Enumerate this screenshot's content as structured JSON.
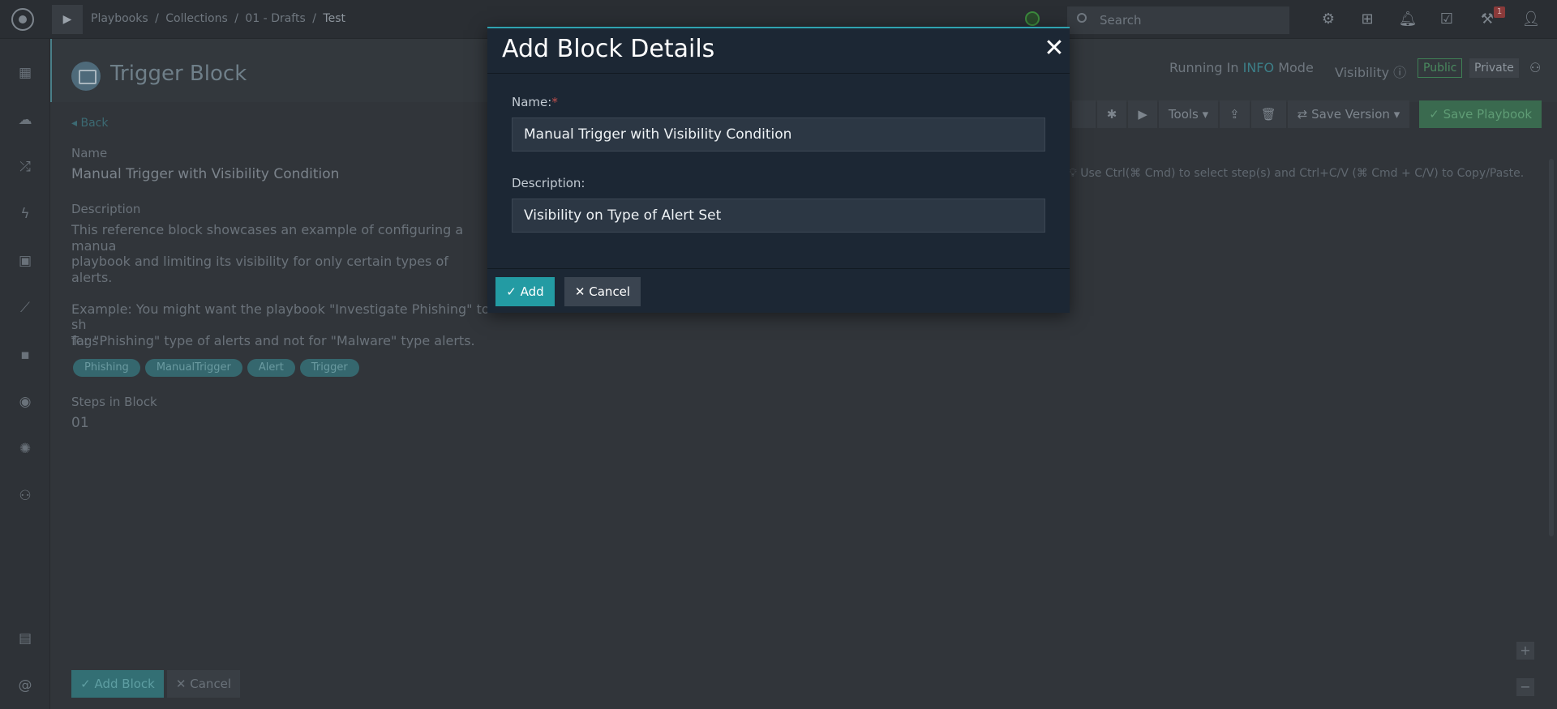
{
  "breadcrumb": {
    "items": [
      "Playbooks",
      "/",
      "Collections",
      "/",
      "01 - Drafts",
      "/"
    ],
    "current": "Test"
  },
  "search": {
    "placeholder": "Search"
  },
  "notifications": {
    "badge": "1"
  },
  "block": {
    "title": "Trigger Block",
    "back_label": "Back",
    "name_label": "Name",
    "name_value": "Manual Trigger with Visibility Condition",
    "description_label": "Description",
    "description_value": "This reference block showcases an example of configuring a manua\nplaybook and limiting its visibility for only certain types of alerts.\n\nExample: You might want the playbook \"Investigate Phishing\" to sh\nfor \"Phishing\" type of alerts and not for \"Malware\" type alerts.",
    "tags_label": "Tags",
    "tags": [
      "Phishing",
      "ManualTrigger",
      "Alert",
      "Trigger"
    ],
    "steps_label": "Steps in Block",
    "steps_value": "01",
    "add_button": "Add Block",
    "cancel_button": "Cancel"
  },
  "mode": {
    "prefix": "Running In",
    "value": "INFO",
    "suffix": "Mode"
  },
  "visibility": {
    "label": "Visibility",
    "public": "Public",
    "private": "Private"
  },
  "toolbar": {
    "tools": "Tools",
    "save_version": "Save Version",
    "save_playbook": "Save Playbook"
  },
  "hint": "Use Ctrl(⌘ Cmd) to select step(s) and Ctrl+C/V (⌘ Cmd + C/V) to Copy/Paste.",
  "modal": {
    "title": "Add Block Details",
    "name_label": "Name:",
    "required_mark": "*",
    "name_value": "Manual Trigger with Visibility Condition",
    "description_label": "Description:",
    "description_value": "Visibility on Type of Alert Set",
    "add_label": "Add",
    "cancel_label": "Cancel"
  },
  "colors": {
    "accent": "#239ba3",
    "modal_bg": "#1c2734",
    "required": "#c0504d"
  }
}
